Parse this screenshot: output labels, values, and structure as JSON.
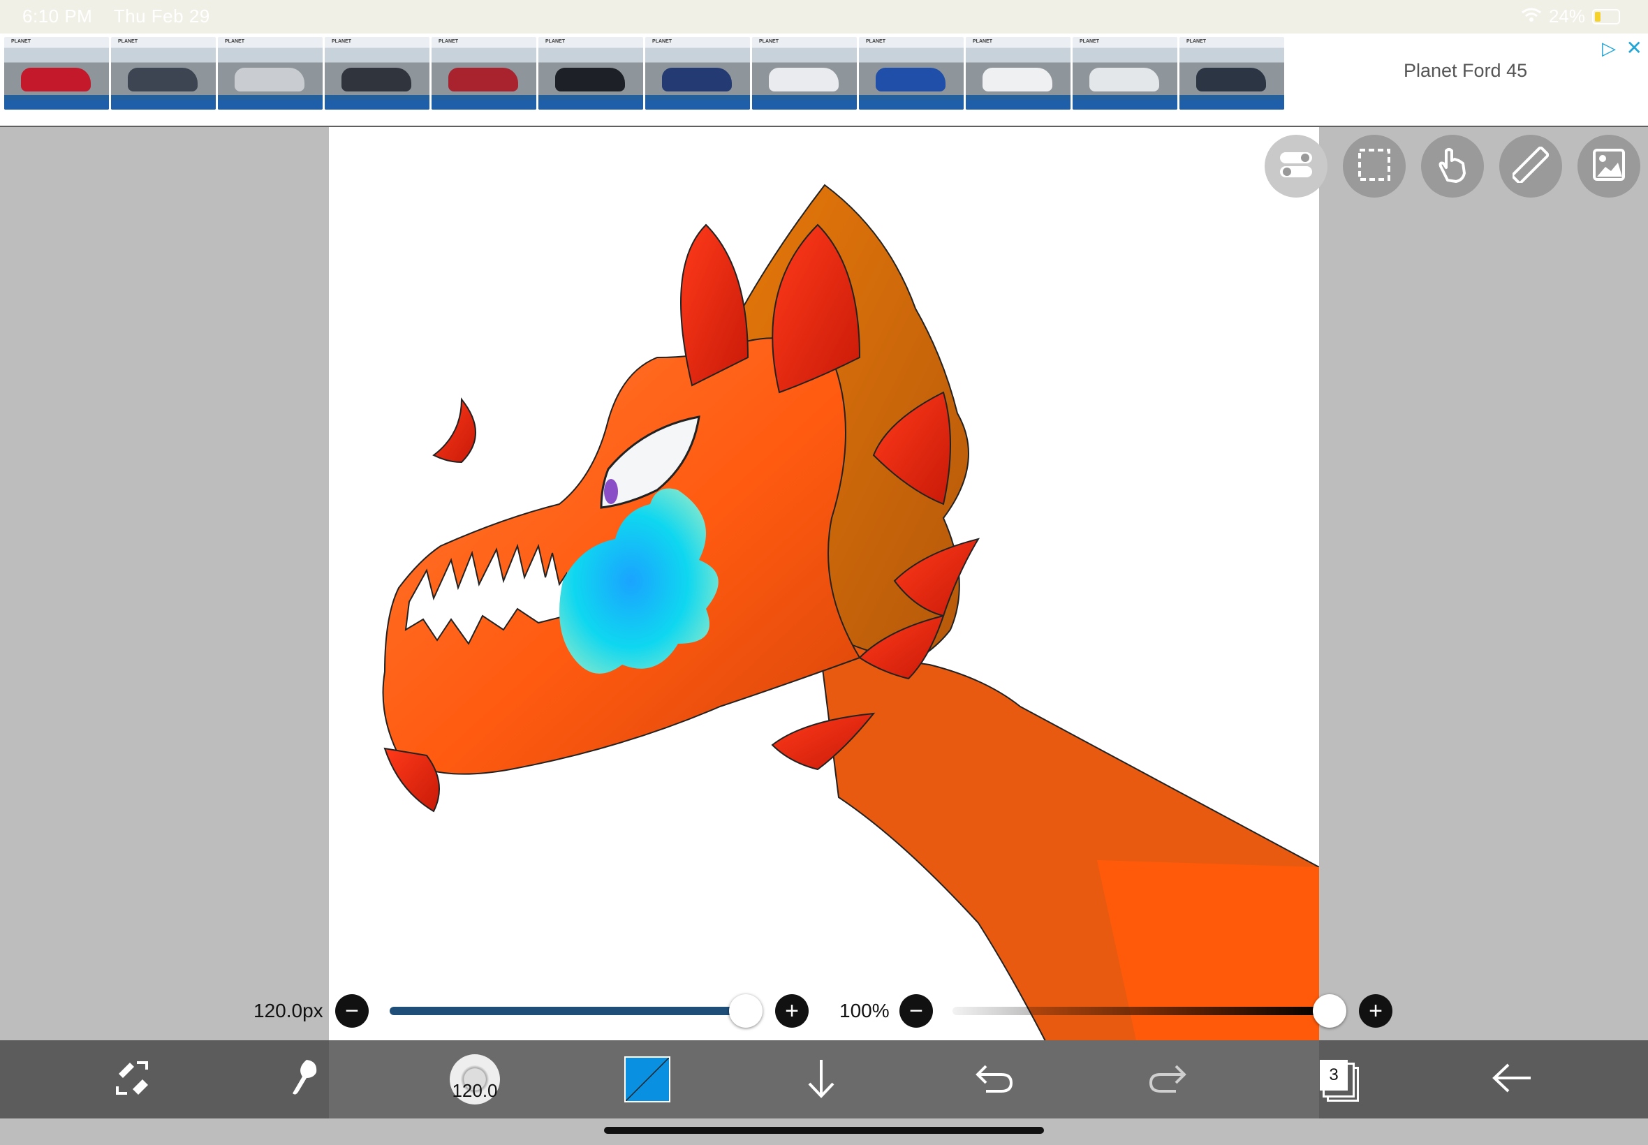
{
  "status_bar": {
    "time": "6:10 PM",
    "date": "Thu Feb 29",
    "battery": "24%"
  },
  "ad": {
    "title": "Planet Ford 45",
    "brand": "PLANET",
    "thumbnails": [
      {
        "car_color": "#c4182b"
      },
      {
        "car_color": "#3d4552"
      },
      {
        "car_color": "#c9cdd2"
      },
      {
        "car_color": "#30353d"
      },
      {
        "car_color": "#a8232d"
      },
      {
        "car_color": "#1d2027"
      },
      {
        "car_color": "#233a72"
      },
      {
        "car_color": "#e9ebee"
      },
      {
        "car_color": "#1f4fa8"
      },
      {
        "car_color": "#eef0f2"
      },
      {
        "car_color": "#e4e7ea"
      },
      {
        "car_color": "#2b3544"
      }
    ]
  },
  "tools": {
    "buttons": [
      {
        "name": "toggle-panel-icon",
        "active": true
      },
      {
        "name": "selection-icon",
        "active": false
      },
      {
        "name": "hand-tool-icon",
        "active": false
      },
      {
        "name": "ruler-icon",
        "active": false
      },
      {
        "name": "material-icon",
        "active": false
      }
    ]
  },
  "brush": {
    "size_label": "120.0px",
    "size_fraction": 1.0,
    "opacity_label": "100%",
    "opacity_fraction": 1.0,
    "size_badge": "120.0"
  },
  "toolbar": {
    "layers_count": "3"
  },
  "colors": {
    "accent": "#0a90e0",
    "size_track": "#1f4e79",
    "background": "#bdbdbd",
    "toolbar": "#5c5c5c"
  }
}
